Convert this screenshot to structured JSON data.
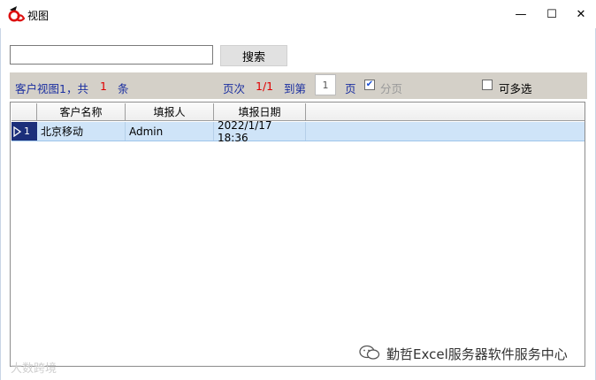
{
  "window": {
    "title": "视图",
    "minimize_glyph": "—",
    "maximize_glyph": "☐",
    "close_glyph": "✕"
  },
  "search": {
    "value": "",
    "placeholder": "",
    "button_label": "搜索"
  },
  "info": {
    "view_name": "客户视图1，共",
    "count": "1",
    "count_unit": "条",
    "page_label": "页次",
    "page_value": "1/1",
    "goto_label": "到第",
    "goto_value": "1",
    "goto_unit": "页",
    "paging_label": "分页",
    "paging_checked": true,
    "multiselect_label": "可多选",
    "multiselect_checked": false
  },
  "grid": {
    "columns": [
      "客户名称",
      "填报人",
      "填报日期"
    ],
    "rows": [
      {
        "index": "1",
        "cells": [
          "北京移动",
          "Admin",
          "2022/1/17 18:36"
        ]
      }
    ]
  },
  "watermark": {
    "left": "大数跨境",
    "right": "勤哲Excel服务器软件服务中心"
  },
  "colors": {
    "accent_blue": "#1a2ea0",
    "count_red": "#e00000",
    "row_selected": "#cfe4f8"
  }
}
